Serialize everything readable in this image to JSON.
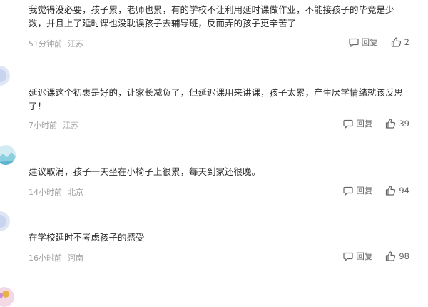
{
  "comments": [
    {
      "text_lines": [
        "我觉得没必要，孩子累，老师也累，有的学校不让利用延时课做作业，不能接孩子的毕竟是少",
        "数，并且上了延时课也没耽误孩子去辅导班，反而弄的孩子更辛苦了"
      ],
      "time": "51分钟前",
      "location": "江苏",
      "reply_label": "回复",
      "likes": "2"
    },
    {
      "text_lines": [
        "延迟课这个初衷是好的，让家长减负了，但延迟课用来讲课，孩子太累，产生厌学情绪就该反思",
        "了！"
      ],
      "time": "7小时前",
      "location": "江苏",
      "reply_label": "回复",
      "likes": "39"
    },
    {
      "text_lines": [
        "建议取消，孩子一天坐在小椅子上很累，每天到家还很晚。"
      ],
      "time": "14小时前",
      "location": "北京",
      "reply_label": "回复",
      "likes": "94"
    },
    {
      "text_lines": [
        "在学校延时不考虑孩子的感受"
      ],
      "time": "16小时前",
      "location": "河南",
      "reply_label": "回复",
      "likes": "98"
    }
  ],
  "colors": {
    "meta": "#a0a0a0",
    "text": "#2b2b2b",
    "action": "#666666"
  },
  "icons": {
    "reply": "comment-bubble-icon",
    "like": "thumbs-up-icon"
  }
}
